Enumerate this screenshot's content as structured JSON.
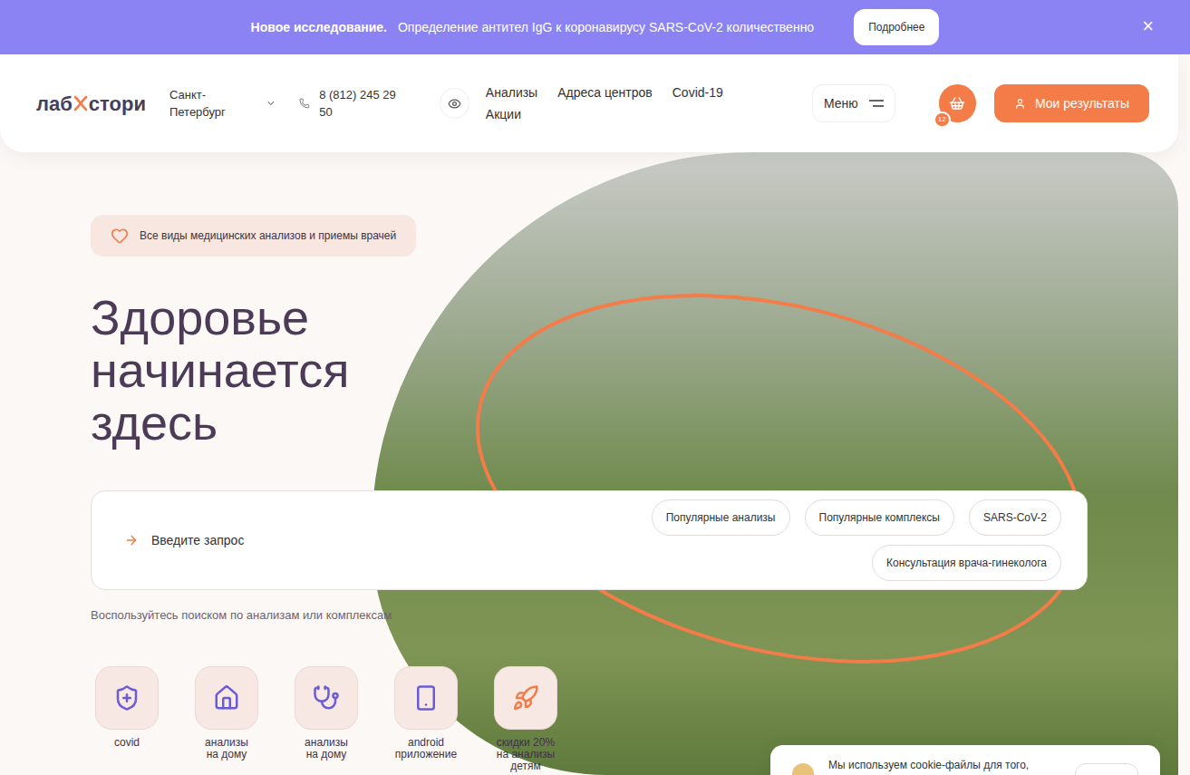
{
  "banner": {
    "title": "Новое исследование.",
    "text": "Определение антител IgG к коронавирусу SARS-CoV-2 количественно",
    "button": "Подробнее",
    "close": "×"
  },
  "header": {
    "logo": [
      "лаб",
      "стори"
    ],
    "city": "Санкт-Петербург",
    "phone": "8 (812) 245 29 50",
    "nav": [
      "Анализы",
      "Адреса центров",
      "Covid-19",
      "Акции"
    ],
    "menu": "Меню",
    "cart_count": "12",
    "results_button": "Мои результаты"
  },
  "hero": {
    "badge": "Все виды медицинских анализов и приемы врачей",
    "heading": [
      "Здоровье",
      "начинается",
      "здесь"
    ]
  },
  "search": {
    "placeholder": "Введите запрос",
    "chips": [
      "Популярные анализы",
      "Популярные комплексы",
      "SARS-CoV-2",
      "Консультация врача-гинеколога"
    ],
    "hint": "Воспользуйтесь поиском по анализам или комплексам"
  },
  "categories": [
    {
      "kind": "covid",
      "label": [
        "covid"
      ]
    },
    {
      "kind": "home",
      "label": [
        "анализы",
        "на дому"
      ]
    },
    {
      "kind": "doctor",
      "label": [
        "анализы",
        "на дому"
      ]
    },
    {
      "kind": "app",
      "label": [
        "android",
        "приложение"
      ]
    },
    {
      "kind": "kids",
      "label": [
        "скидки 20%",
        "на анализы",
        "детям"
      ]
    }
  ],
  "cookie": {
    "text": "Мы используем cookie-файлы для того,"
  }
}
